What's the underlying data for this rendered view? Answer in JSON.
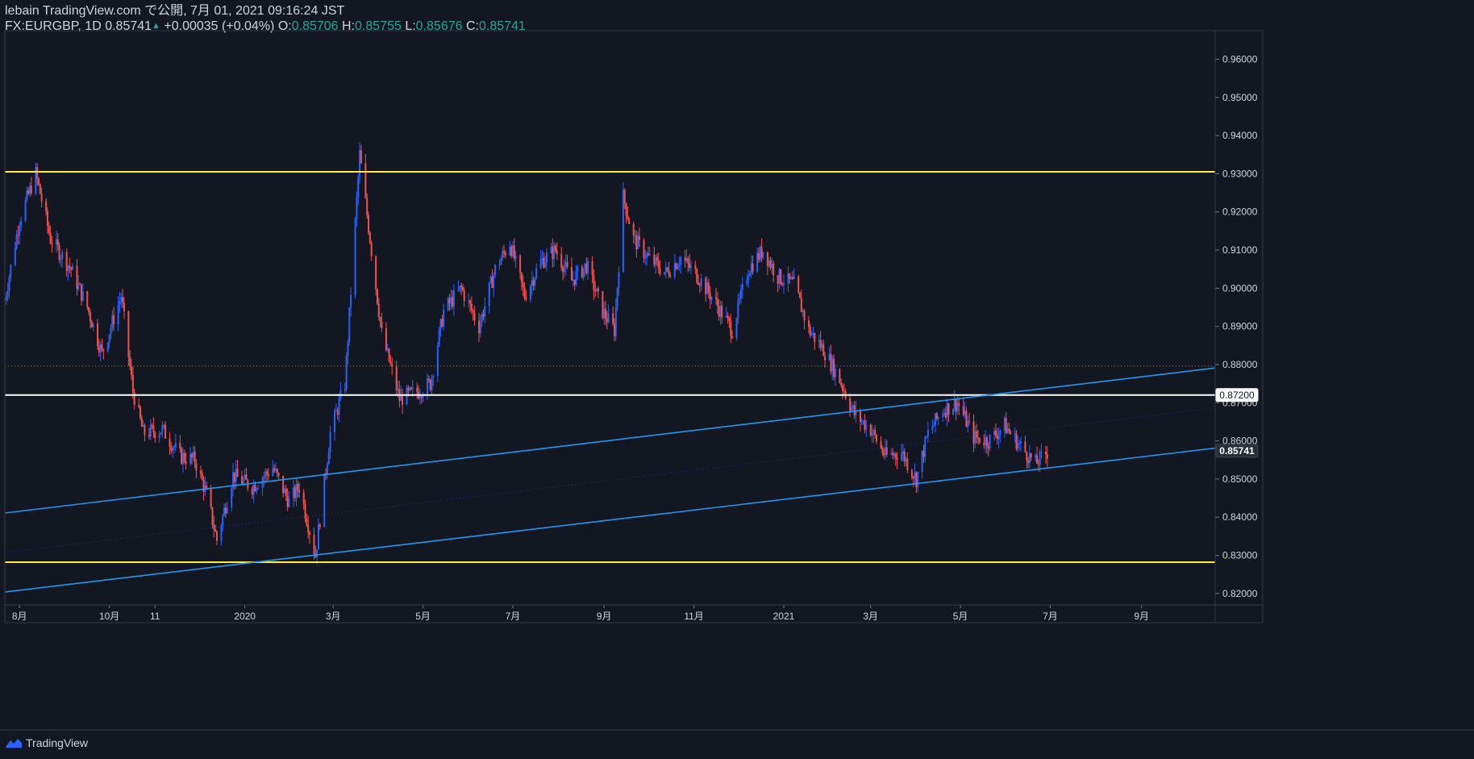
{
  "header": {
    "published": "lebain TradingView.com で公開, 7月 01, 2021 09:16:24 JST",
    "symbol": "FX:EURGBP, 1D",
    "last": "0.85741",
    "change": "+0.00035 (+0.04%)",
    "o_label": "O:",
    "o_value": "0.85706",
    "h_label": "H:",
    "h_value": "0.85755",
    "l_label": "L:",
    "l_value": "0.85676",
    "c_label": "C:",
    "c_value": "0.85741"
  },
  "footer": {
    "brand": "TradingView",
    "icon": "tradingview-logo-icon"
  },
  "colors": {
    "background": "#131722",
    "up": "#2962ff",
    "down": "#ef5350",
    "support_resistance": "#ffeb3b",
    "key_level": "#ffffff",
    "channel": "#2196f3",
    "text": "#d1d4dc",
    "ohlc_value": "#26a69a"
  },
  "chart_data": {
    "type": "candlestick",
    "symbol": "FX:EURGBP",
    "timeframe": "1D",
    "ylim": [
      0.817,
      0.9675
    ],
    "price_ticks": [
      "0.96000",
      "0.95000",
      "0.94000",
      "0.93000",
      "0.92000",
      "0.91000",
      "0.90000",
      "0.89000",
      "0.88000",
      "0.87000",
      "0.86000",
      "0.85000",
      "0.84000",
      "0.83000",
      "0.82000"
    ],
    "date_ticks": [
      "8月",
      "10月",
      "11",
      "2020",
      "3月",
      "5月",
      "7月",
      "9月",
      "11月",
      "2021",
      "3月",
      "5月",
      "7月",
      "9月"
    ],
    "price_labels": [
      {
        "text": "0.87200",
        "value": 0.872,
        "style": "white"
      },
      {
        "text": "0.85741",
        "value": 0.85741,
        "style": "dark"
      }
    ],
    "horizontal_lines": [
      {
        "name": "resistance",
        "value": 0.9305,
        "color": "#ffeb3b"
      },
      {
        "name": "support",
        "value": 0.8282,
        "color": "#ffeb3b"
      },
      {
        "name": "key-level",
        "value": 0.872,
        "color": "#ffffff"
      },
      {
        "name": "dotted-level",
        "value": 0.8796,
        "color": "#9e7f4f",
        "style": "dotted"
      }
    ],
    "channel_lines": [
      {
        "name": "channel-upper",
        "points": [
          [
            "2019-07-22",
            0.8411
          ],
          [
            "2021-10-21",
            0.8791
          ]
        ]
      },
      {
        "name": "channel-lower",
        "points": [
          [
            "2019-07-22",
            0.8204
          ],
          [
            "2021-10-21",
            0.8581
          ]
        ]
      }
    ],
    "series": [
      {
        "date": "2019-07-22",
        "close": 0.897
      },
      {
        "date": "2019-08-01",
        "close": 0.918
      },
      {
        "date": "2019-08-12",
        "close": 0.93
      },
      {
        "date": "2019-08-22",
        "close": 0.913
      },
      {
        "date": "2019-09-05",
        "close": 0.905
      },
      {
        "date": "2019-09-16",
        "close": 0.895
      },
      {
        "date": "2019-09-26",
        "close": 0.883
      },
      {
        "date": "2019-10-09",
        "close": 0.898
      },
      {
        "date": "2019-10-17",
        "close": 0.873
      },
      {
        "date": "2019-10-24",
        "close": 0.862
      },
      {
        "date": "2019-11-06",
        "close": 0.863
      },
      {
        "date": "2019-11-18",
        "close": 0.856
      },
      {
        "date": "2019-11-28",
        "close": 0.855
      },
      {
        "date": "2019-12-06",
        "close": 0.846
      },
      {
        "date": "2019-12-13",
        "close": 0.834
      },
      {
        "date": "2019-12-24",
        "close": 0.851
      },
      {
        "date": "2020-01-06",
        "close": 0.848
      },
      {
        "date": "2020-01-20",
        "close": 0.853
      },
      {
        "date": "2020-01-31",
        "close": 0.844
      },
      {
        "date": "2020-02-07",
        "close": 0.848
      },
      {
        "date": "2020-02-18",
        "close": 0.83
      },
      {
        "date": "2020-02-28",
        "close": 0.862
      },
      {
        "date": "2020-03-09",
        "close": 0.875
      },
      {
        "date": "2020-03-19",
        "close": 0.935
      },
      {
        "date": "2020-03-26",
        "close": 0.913
      },
      {
        "date": "2020-04-03",
        "close": 0.888
      },
      {
        "date": "2020-04-15",
        "close": 0.871
      },
      {
        "date": "2020-04-28",
        "close": 0.873
      },
      {
        "date": "2020-05-06",
        "close": 0.875
      },
      {
        "date": "2020-05-15",
        "close": 0.894
      },
      {
        "date": "2020-05-27",
        "close": 0.9
      },
      {
        "date": "2020-06-08",
        "close": 0.89
      },
      {
        "date": "2020-06-19",
        "close": 0.905
      },
      {
        "date": "2020-06-29",
        "close": 0.912
      },
      {
        "date": "2020-07-09",
        "close": 0.898
      },
      {
        "date": "2020-07-20",
        "close": 0.907
      },
      {
        "date": "2020-07-30",
        "close": 0.91
      },
      {
        "date": "2020-08-10",
        "close": 0.902
      },
      {
        "date": "2020-08-20",
        "close": 0.906
      },
      {
        "date": "2020-08-31",
        "close": 0.894
      },
      {
        "date": "2020-09-08",
        "close": 0.889
      },
      {
        "date": "2020-09-14",
        "close": 0.924
      },
      {
        "date": "2020-09-21",
        "close": 0.913
      },
      {
        "date": "2020-10-01",
        "close": 0.908
      },
      {
        "date": "2020-10-13",
        "close": 0.904
      },
      {
        "date": "2020-10-23",
        "close": 0.908
      },
      {
        "date": "2020-11-04",
        "close": 0.903
      },
      {
        "date": "2020-11-16",
        "close": 0.896
      },
      {
        "date": "2020-11-27",
        "close": 0.889
      },
      {
        "date": "2020-12-08",
        "close": 0.905
      },
      {
        "date": "2020-12-18",
        "close": 0.91
      },
      {
        "date": "2020-12-28",
        "close": 0.903
      },
      {
        "date": "2021-01-08",
        "close": 0.901
      },
      {
        "date": "2021-01-18",
        "close": 0.889
      },
      {
        "date": "2021-01-28",
        "close": 0.884
      },
      {
        "date": "2021-02-08",
        "close": 0.876
      },
      {
        "date": "2021-02-18",
        "close": 0.867
      },
      {
        "date": "2021-03-01",
        "close": 0.863
      },
      {
        "date": "2021-03-11",
        "close": 0.856
      },
      {
        "date": "2021-03-22",
        "close": 0.857
      },
      {
        "date": "2021-04-01",
        "close": 0.85
      },
      {
        "date": "2021-04-09",
        "close": 0.862
      },
      {
        "date": "2021-04-19",
        "close": 0.868
      },
      {
        "date": "2021-04-29",
        "close": 0.87
      },
      {
        "date": "2021-05-10",
        "close": 0.861
      },
      {
        "date": "2021-05-20",
        "close": 0.86
      },
      {
        "date": "2021-05-31",
        "close": 0.864
      },
      {
        "date": "2021-06-10",
        "close": 0.859
      },
      {
        "date": "2021-06-21",
        "close": 0.854
      },
      {
        "date": "2021-06-30",
        "close": 0.8574
      }
    ]
  }
}
